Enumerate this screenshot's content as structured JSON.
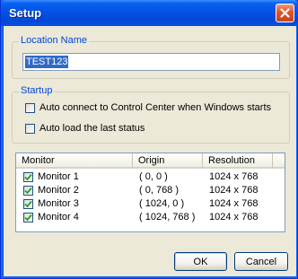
{
  "window": {
    "title": "Setup"
  },
  "location": {
    "group_label": "Location Name",
    "value": "TEST123"
  },
  "startup": {
    "group_label": "Startup",
    "options": [
      {
        "label": "Auto connect to Control Center when Windows starts",
        "checked": false
      },
      {
        "label": "Auto load the last status",
        "checked": false
      }
    ]
  },
  "monitors": {
    "columns": [
      "Monitor",
      "Origin",
      "Resolution"
    ],
    "rows": [
      {
        "name": "Monitor 1",
        "origin": "( 0, 0 )",
        "resolution": "1024 x 768",
        "checked": true
      },
      {
        "name": "Monitor 2",
        "origin": "( 0, 768 )",
        "resolution": "1024 x 768",
        "checked": true
      },
      {
        "name": "Monitor 3",
        "origin": "( 1024, 0 )",
        "resolution": "1024 x 768",
        "checked": true
      },
      {
        "name": "Monitor 4",
        "origin": "( 1024, 768 )",
        "resolution": "1024 x 768",
        "checked": true
      }
    ]
  },
  "buttons": {
    "ok": "OK",
    "cancel": "Cancel"
  },
  "colors": {
    "title_bar": "#0451e6",
    "group_label": "#0046d5",
    "selection": "#316ac5",
    "check_mark": "#21a121"
  },
  "icons": {
    "close": "close-icon",
    "check": "check-icon"
  }
}
